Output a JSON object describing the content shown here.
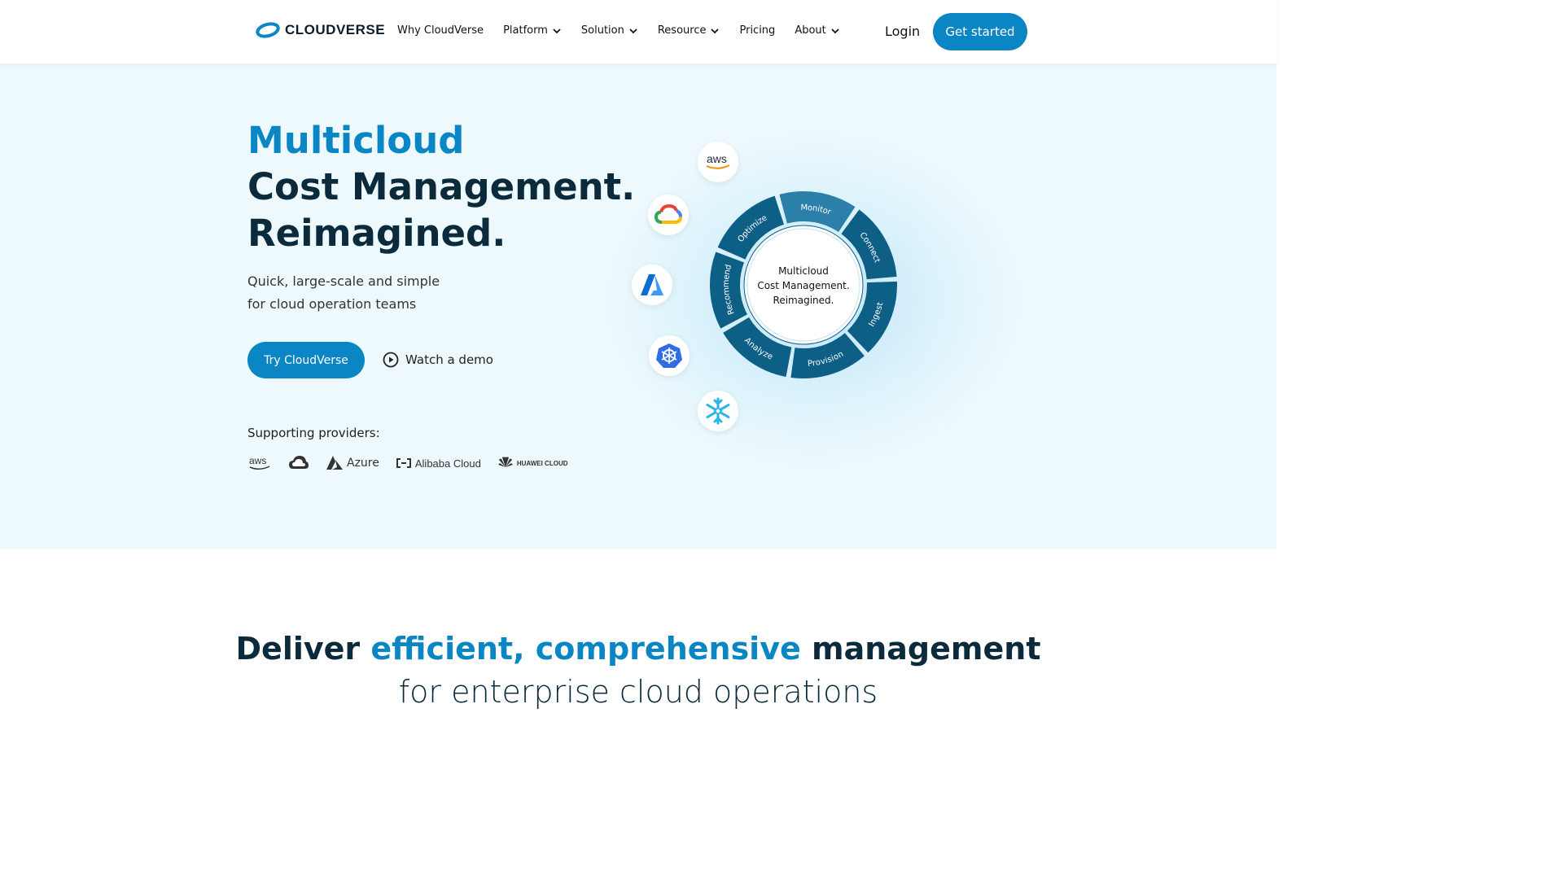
{
  "nav": {
    "logo_text": "CLOUDVERSE",
    "items": [
      {
        "label": "Why CloudVerse",
        "dropdown": false
      },
      {
        "label": "Platform",
        "dropdown": true
      },
      {
        "label": "Solution",
        "dropdown": true
      },
      {
        "label": "Resource",
        "dropdown": true
      },
      {
        "label": "Pricing",
        "dropdown": false
      },
      {
        "label": "About",
        "dropdown": true
      }
    ],
    "login": "Login",
    "get_started": "Get started"
  },
  "hero": {
    "title_accent": "Multicloud",
    "title_line2": "Cost Management.",
    "title_line3": "Reimagined.",
    "subtitle_line1": "Quick, large-scale and simple",
    "subtitle_line2": "for cloud operation teams",
    "try_button": "Try CloudVerse",
    "demo_link": "Watch a demo",
    "support_label": "Supporting providers:",
    "providers": [
      "aws",
      "Google Cloud",
      "Azure",
      "Alibaba Cloud",
      "HUAWEI CLOUD"
    ]
  },
  "diagram": {
    "center_line1": "Multicloud",
    "center_line2": "Cost Management.",
    "center_line3": "Reimagined.",
    "segments": [
      "Connect",
      "Ingest",
      "Provision",
      "Analyze",
      "Recommend",
      "Optimize",
      "Monitor"
    ],
    "bubbles": [
      "aws",
      "google-cloud-icon",
      "azure-icon",
      "kubernetes-icon",
      "snowflake-icon"
    ],
    "colors": {
      "segment": "#0e5f86",
      "segment_light": "#2c7fa8",
      "accent": "#0b86c4"
    }
  },
  "section2": {
    "line1_part1": "Deliver ",
    "line1_accent": "efficient, comprehensive",
    "line1_part2": " management",
    "line2": "for enterprise cloud operations"
  }
}
